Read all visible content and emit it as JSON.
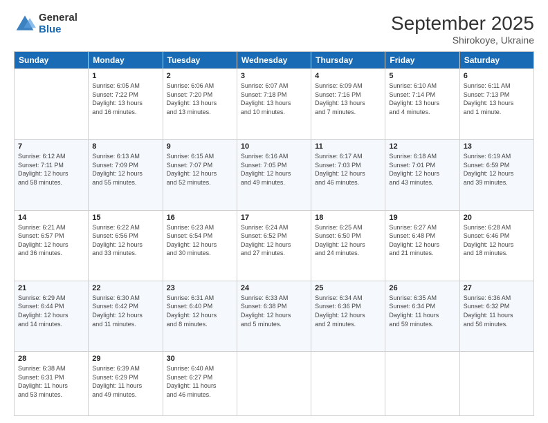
{
  "header": {
    "logo_general": "General",
    "logo_blue": "Blue",
    "month_title": "September 2025",
    "subtitle": "Shirokoye, Ukraine"
  },
  "weekdays": [
    "Sunday",
    "Monday",
    "Tuesday",
    "Wednesday",
    "Thursday",
    "Friday",
    "Saturday"
  ],
  "weeks": [
    [
      {
        "day": "",
        "info": ""
      },
      {
        "day": "1",
        "info": "Sunrise: 6:05 AM\nSunset: 7:22 PM\nDaylight: 13 hours\nand 16 minutes."
      },
      {
        "day": "2",
        "info": "Sunrise: 6:06 AM\nSunset: 7:20 PM\nDaylight: 13 hours\nand 13 minutes."
      },
      {
        "day": "3",
        "info": "Sunrise: 6:07 AM\nSunset: 7:18 PM\nDaylight: 13 hours\nand 10 minutes."
      },
      {
        "day": "4",
        "info": "Sunrise: 6:09 AM\nSunset: 7:16 PM\nDaylight: 13 hours\nand 7 minutes."
      },
      {
        "day": "5",
        "info": "Sunrise: 6:10 AM\nSunset: 7:14 PM\nDaylight: 13 hours\nand 4 minutes."
      },
      {
        "day": "6",
        "info": "Sunrise: 6:11 AM\nSunset: 7:13 PM\nDaylight: 13 hours\nand 1 minute."
      }
    ],
    [
      {
        "day": "7",
        "info": "Sunrise: 6:12 AM\nSunset: 7:11 PM\nDaylight: 12 hours\nand 58 minutes."
      },
      {
        "day": "8",
        "info": "Sunrise: 6:13 AM\nSunset: 7:09 PM\nDaylight: 12 hours\nand 55 minutes."
      },
      {
        "day": "9",
        "info": "Sunrise: 6:15 AM\nSunset: 7:07 PM\nDaylight: 12 hours\nand 52 minutes."
      },
      {
        "day": "10",
        "info": "Sunrise: 6:16 AM\nSunset: 7:05 PM\nDaylight: 12 hours\nand 49 minutes."
      },
      {
        "day": "11",
        "info": "Sunrise: 6:17 AM\nSunset: 7:03 PM\nDaylight: 12 hours\nand 46 minutes."
      },
      {
        "day": "12",
        "info": "Sunrise: 6:18 AM\nSunset: 7:01 PM\nDaylight: 12 hours\nand 43 minutes."
      },
      {
        "day": "13",
        "info": "Sunrise: 6:19 AM\nSunset: 6:59 PM\nDaylight: 12 hours\nand 39 minutes."
      }
    ],
    [
      {
        "day": "14",
        "info": "Sunrise: 6:21 AM\nSunset: 6:57 PM\nDaylight: 12 hours\nand 36 minutes."
      },
      {
        "day": "15",
        "info": "Sunrise: 6:22 AM\nSunset: 6:56 PM\nDaylight: 12 hours\nand 33 minutes."
      },
      {
        "day": "16",
        "info": "Sunrise: 6:23 AM\nSunset: 6:54 PM\nDaylight: 12 hours\nand 30 minutes."
      },
      {
        "day": "17",
        "info": "Sunrise: 6:24 AM\nSunset: 6:52 PM\nDaylight: 12 hours\nand 27 minutes."
      },
      {
        "day": "18",
        "info": "Sunrise: 6:25 AM\nSunset: 6:50 PM\nDaylight: 12 hours\nand 24 minutes."
      },
      {
        "day": "19",
        "info": "Sunrise: 6:27 AM\nSunset: 6:48 PM\nDaylight: 12 hours\nand 21 minutes."
      },
      {
        "day": "20",
        "info": "Sunrise: 6:28 AM\nSunset: 6:46 PM\nDaylight: 12 hours\nand 18 minutes."
      }
    ],
    [
      {
        "day": "21",
        "info": "Sunrise: 6:29 AM\nSunset: 6:44 PM\nDaylight: 12 hours\nand 14 minutes."
      },
      {
        "day": "22",
        "info": "Sunrise: 6:30 AM\nSunset: 6:42 PM\nDaylight: 12 hours\nand 11 minutes."
      },
      {
        "day": "23",
        "info": "Sunrise: 6:31 AM\nSunset: 6:40 PM\nDaylight: 12 hours\nand 8 minutes."
      },
      {
        "day": "24",
        "info": "Sunrise: 6:33 AM\nSunset: 6:38 PM\nDaylight: 12 hours\nand 5 minutes."
      },
      {
        "day": "25",
        "info": "Sunrise: 6:34 AM\nSunset: 6:36 PM\nDaylight: 12 hours\nand 2 minutes."
      },
      {
        "day": "26",
        "info": "Sunrise: 6:35 AM\nSunset: 6:34 PM\nDaylight: 11 hours\nand 59 minutes."
      },
      {
        "day": "27",
        "info": "Sunrise: 6:36 AM\nSunset: 6:32 PM\nDaylight: 11 hours\nand 56 minutes."
      }
    ],
    [
      {
        "day": "28",
        "info": "Sunrise: 6:38 AM\nSunset: 6:31 PM\nDaylight: 11 hours\nand 53 minutes."
      },
      {
        "day": "29",
        "info": "Sunrise: 6:39 AM\nSunset: 6:29 PM\nDaylight: 11 hours\nand 49 minutes."
      },
      {
        "day": "30",
        "info": "Sunrise: 6:40 AM\nSunset: 6:27 PM\nDaylight: 11 hours\nand 46 minutes."
      },
      {
        "day": "",
        "info": ""
      },
      {
        "day": "",
        "info": ""
      },
      {
        "day": "",
        "info": ""
      },
      {
        "day": "",
        "info": ""
      }
    ]
  ]
}
